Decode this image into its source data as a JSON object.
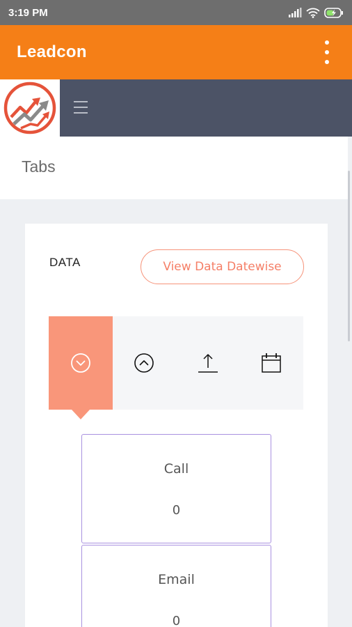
{
  "status_bar": {
    "time": "3:19 PM",
    "icons": [
      "signal-icon",
      "wifi-icon",
      "battery-charging-icon"
    ]
  },
  "app_bar": {
    "title": "Leadcon",
    "overflow_icon": "more-vert-icon"
  },
  "nav": {
    "menu_icon": "hamburger-icon",
    "logo": "leadcon-logo"
  },
  "page": {
    "title": "Tabs"
  },
  "card": {
    "label": "DATA",
    "datewise_button": "View Data Datewise",
    "tabs": [
      {
        "icon": "chevron-down-circle-icon",
        "active": true
      },
      {
        "icon": "chevron-up-circle-icon",
        "active": false
      },
      {
        "icon": "upload-icon",
        "active": false
      },
      {
        "icon": "calendar-icon",
        "active": false
      }
    ],
    "stats": [
      {
        "label": "Call",
        "value": "0"
      },
      {
        "label": "Email",
        "value": "0"
      }
    ]
  },
  "colors": {
    "accent": "#f57f17",
    "nav_bg": "#4c5366",
    "active_tab": "#f9967a",
    "button_border": "#f6937a",
    "stat_border": "#a991e0"
  }
}
